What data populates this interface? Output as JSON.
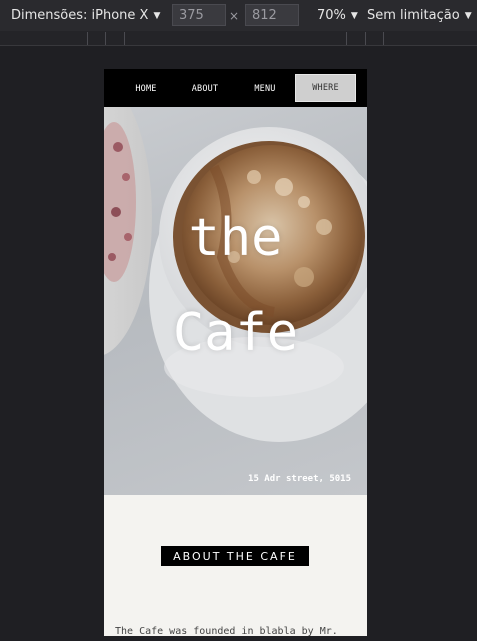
{
  "devtools": {
    "dimensions_label": "Dimensões: iPhone X",
    "width_value": "375",
    "times": "×",
    "height_value": "812",
    "zoom": "70%",
    "throttle": "Sem limitação"
  },
  "site": {
    "nav": [
      {
        "label": "HOME"
      },
      {
        "label": "ABOUT"
      },
      {
        "label": "MENU"
      },
      {
        "label": "WHERE"
      }
    ],
    "hero": {
      "title_line1": "the",
      "title_line2": "Cafe",
      "address": "15 Adr street, 5015"
    },
    "about": {
      "heading": "ABOUT THE CAFE",
      "text": "The Cafe was founded in blabla by Mr."
    }
  },
  "colors": {
    "devtools_bg": "#2a2a2e",
    "canvas_bg": "#1f1f23",
    "nav_bg": "#000000",
    "active_nav_bg": "#cfcfcf",
    "page_bg": "#f4f3f0"
  }
}
